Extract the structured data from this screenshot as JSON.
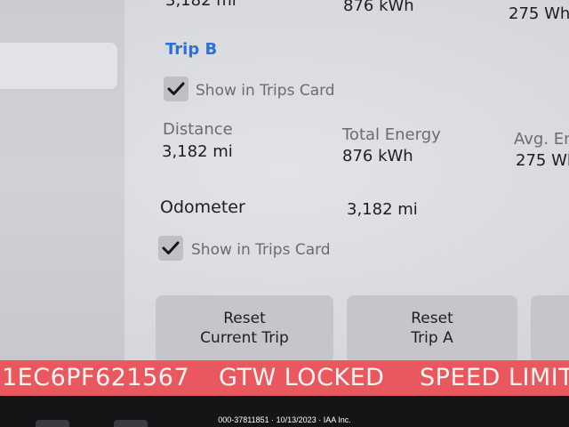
{
  "trip_a": {
    "distance_value": "3,182 mi",
    "total_energy_value": "876 kWh",
    "avg_energy_value": "275 Wh"
  },
  "trip_b": {
    "heading": "Trip B",
    "show_in_card": "Show in Trips Card",
    "show_in_card_checked": true,
    "distance_label": "Distance",
    "distance_value": "3,182 mi",
    "total_energy_label": "Total Energy",
    "total_energy_value": "876 kWh",
    "avg_energy_label": "Avg. En",
    "avg_energy_value": "275 Wl"
  },
  "odometer": {
    "label": "Odometer",
    "value": "3,182 mi",
    "show_in_card": "Show in Trips Card",
    "show_in_card_checked": true
  },
  "buttons": {
    "reset_current_line1": "Reset",
    "reset_current_line2": "Current Trip",
    "reset_a_line1": "Reset",
    "reset_a_line2": "Trip A"
  },
  "alert_banner": {
    "vin_fragment": "1EC6PF621567",
    "gtw_status": "GTW LOCKED",
    "speed_limit": "SPEED LIMIT",
    "background_color": "#e8585e"
  },
  "watermark": {
    "text": "000-37811851 · 10/13/2023 · IAA Inc."
  },
  "colors": {
    "accent": "#2f6fd8",
    "label_gray": "#6b6c72"
  }
}
